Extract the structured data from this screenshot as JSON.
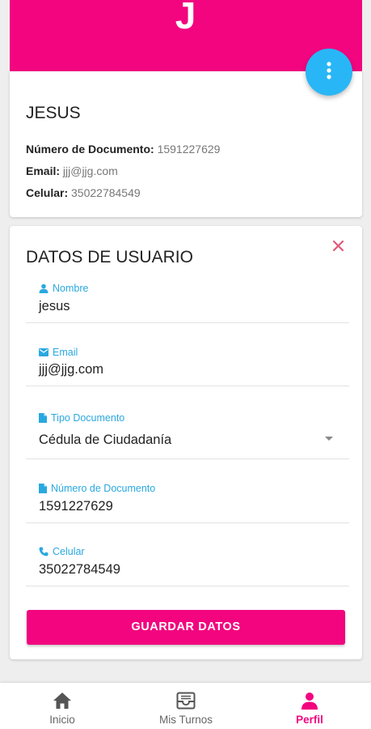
{
  "header": {
    "avatar_letter": "J"
  },
  "profile": {
    "name": "JESUS",
    "document_label": "Número de Documento:",
    "document_value": "1591227629",
    "email_label": "Email:",
    "email_value": "jjj@jjg.com",
    "phone_label": "Celular:",
    "phone_value": "35022784549"
  },
  "form": {
    "title": "DATOS DE USUARIO",
    "fields": [
      {
        "label": "Nombre",
        "value": "jesus",
        "icon": "person-icon"
      },
      {
        "label": "Email",
        "value": "jjj@jjg.com",
        "icon": "email-icon"
      },
      {
        "label": "Tipo Documento",
        "value": "Cédula de Ciudadanía",
        "icon": "document-icon"
      },
      {
        "label": "Número de Documento",
        "value": "1591227629",
        "icon": "document-icon"
      },
      {
        "label": "Celular",
        "value": "35022784549",
        "icon": "phone-icon"
      }
    ],
    "save_label": "GUARDAR DATOS"
  },
  "nav": {
    "items": [
      {
        "label": "Inicio",
        "icon": "home-icon",
        "active": false
      },
      {
        "label": "Mis Turnos",
        "icon": "inbox-icon",
        "active": false
      },
      {
        "label": "Perfil",
        "icon": "person-icon",
        "active": true
      }
    ]
  },
  "colors": {
    "accent": "#f2057f",
    "label_blue": "#29a8e0",
    "fab_blue": "#29b6f6"
  }
}
